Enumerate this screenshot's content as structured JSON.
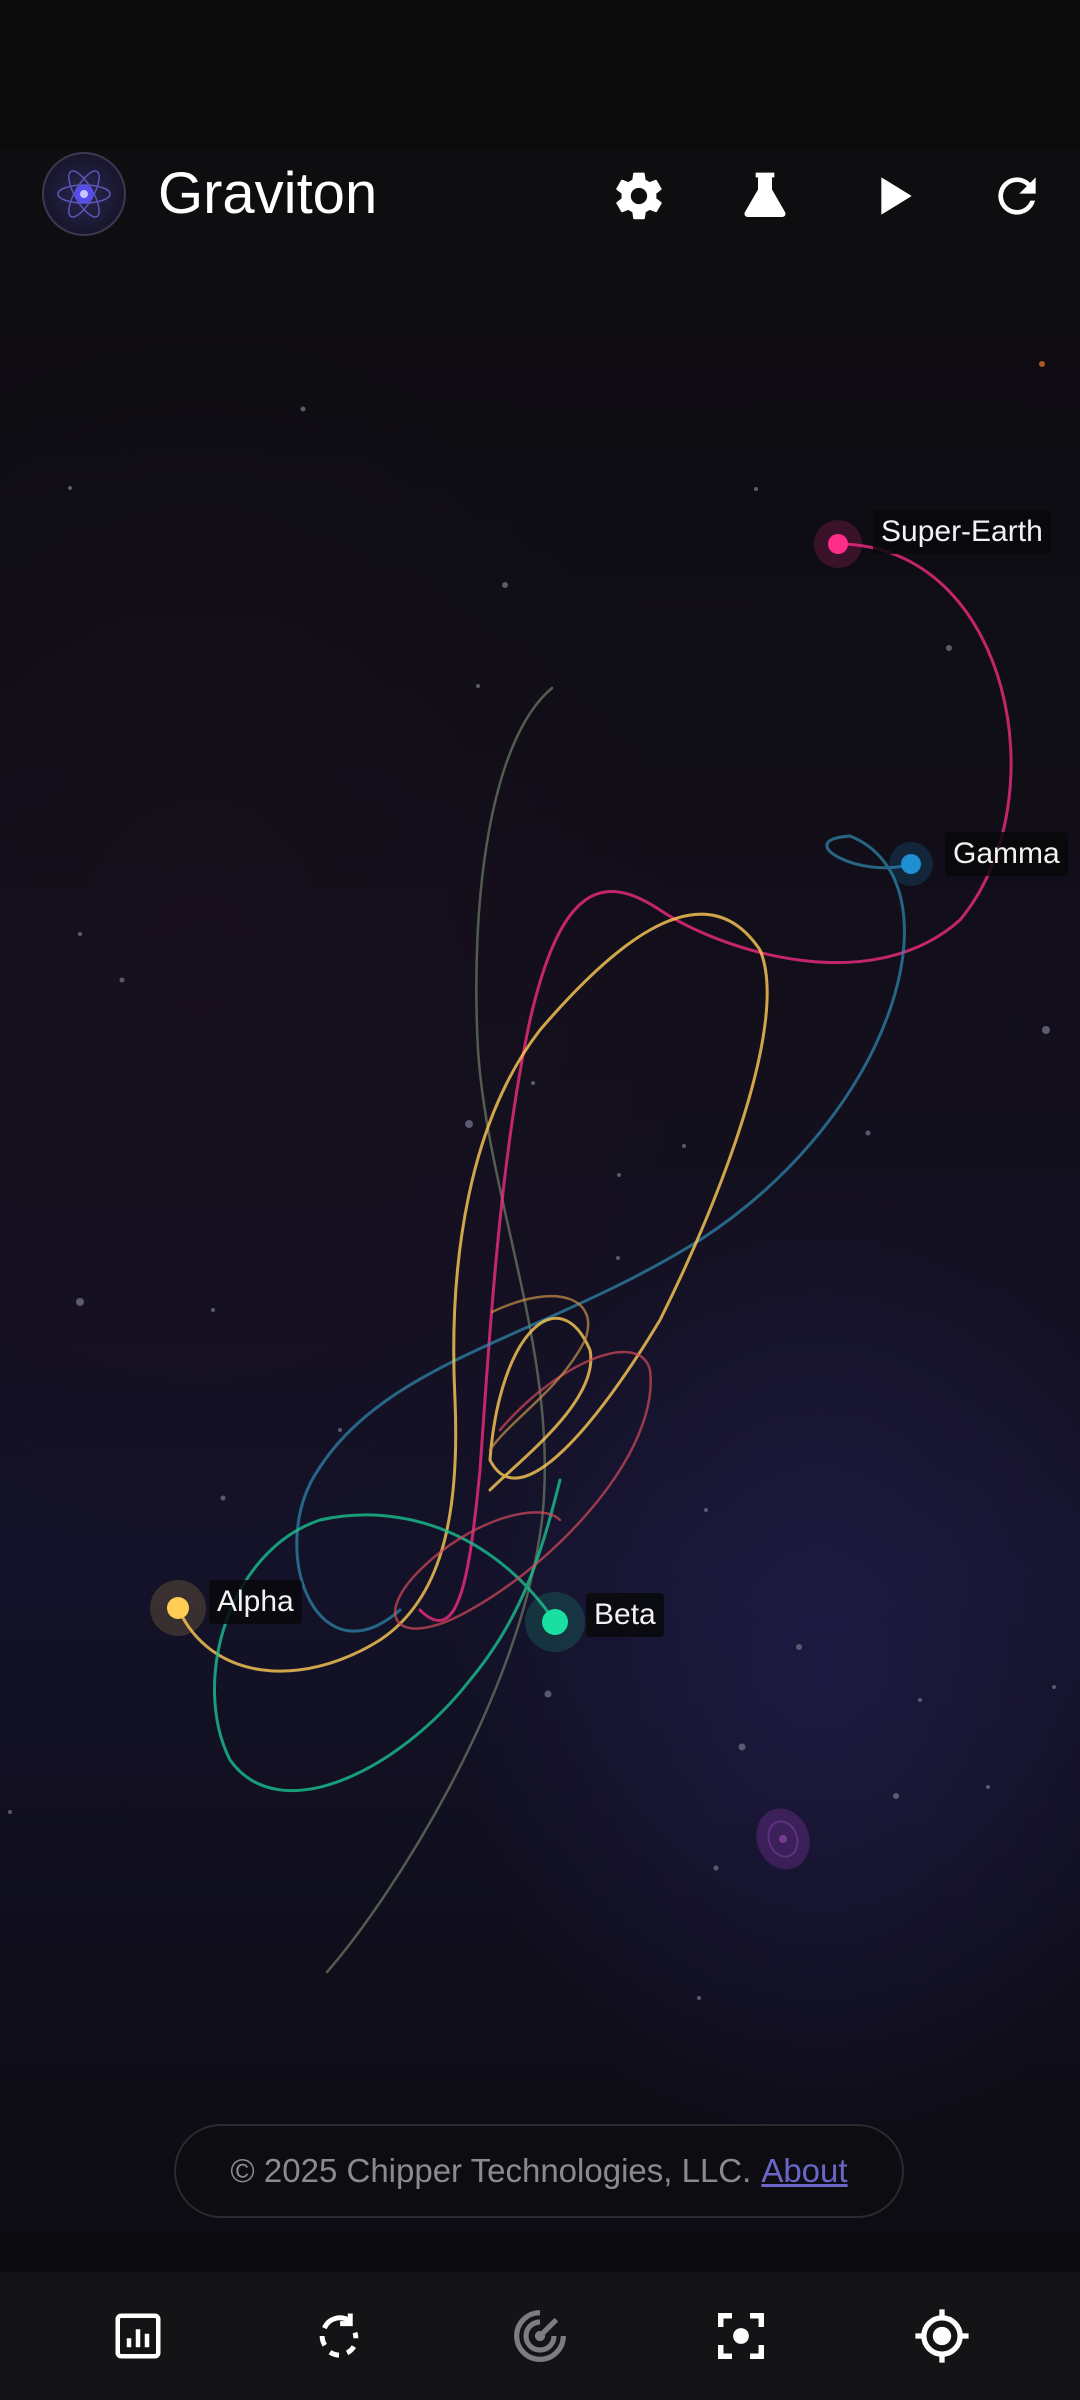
{
  "app": {
    "title": "Graviton",
    "toolbar": {
      "settings_icon": "gear-icon",
      "lab_icon": "flask-icon",
      "play_icon": "play-icon",
      "reset_icon": "refresh-icon"
    }
  },
  "simulation": {
    "bodies": [
      {
        "name": "Super-Earth",
        "color": "#ff2e88"
      },
      {
        "name": "Gamma",
        "color": "#1e8fd0"
      },
      {
        "name": "Alpha",
        "color": "#ffcc55"
      },
      {
        "name": "Beta",
        "color": "#19e0a0"
      }
    ]
  },
  "footer": {
    "copyright": "© 2025 Chipper Technologies, LLC.",
    "about_link": "About"
  },
  "bottom_nav": {
    "items": [
      "stats-icon",
      "rotate-icon",
      "radar-icon",
      "focus-frame-icon",
      "target-icon"
    ]
  },
  "colors": {
    "background": "#0b0a0d",
    "accent": "#6a66c8"
  }
}
